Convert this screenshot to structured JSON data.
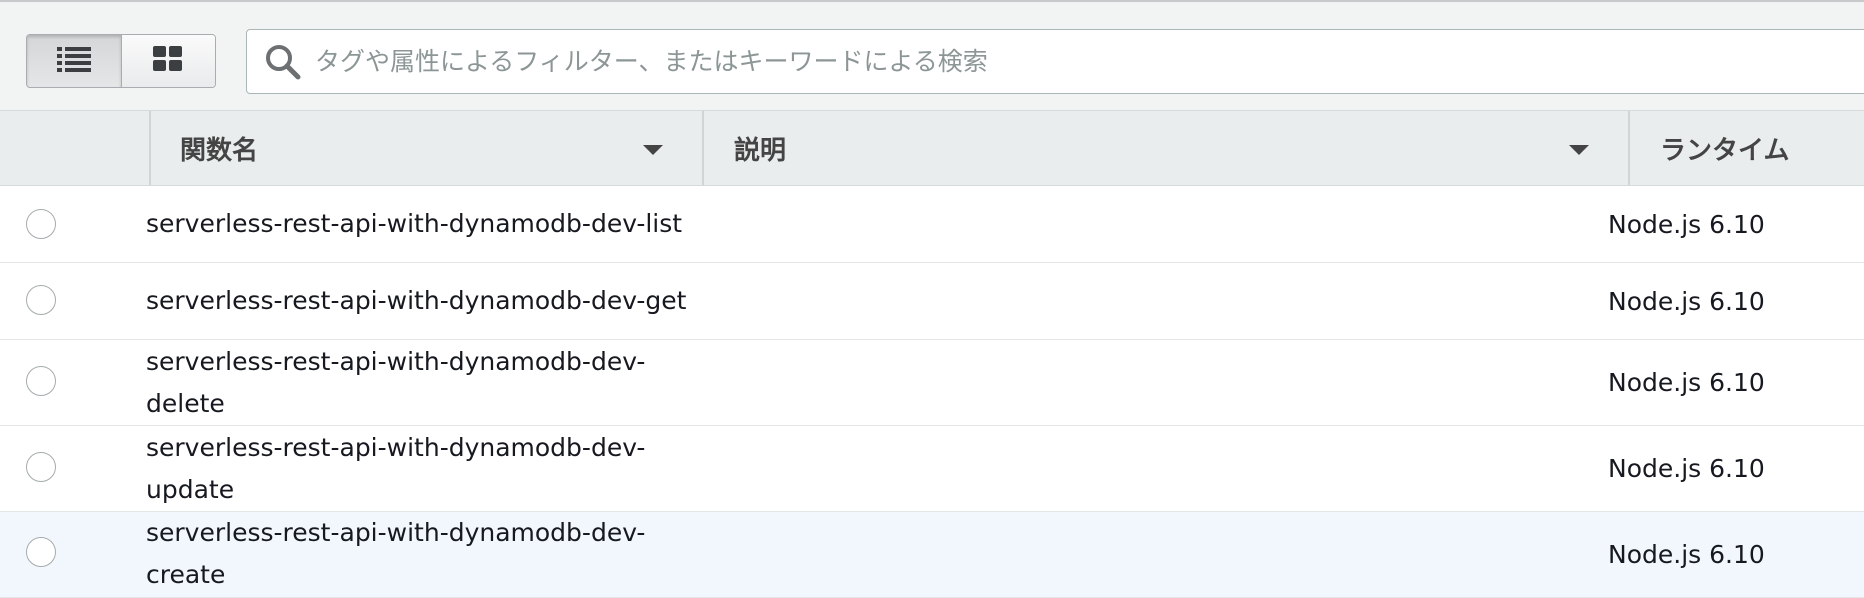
{
  "toolbar": {
    "view_toggle": {
      "list_icon": "list-icon",
      "grid_icon": "grid-icon",
      "active": "list"
    },
    "search": {
      "icon": "search-icon",
      "placeholder": "タグや属性によるフィルター、またはキーワードによる検索",
      "value": ""
    }
  },
  "table": {
    "columns": [
      {
        "label": "関数名",
        "sortable": true
      },
      {
        "label": "説明",
        "sortable": true
      },
      {
        "label": "ランタイム",
        "sortable": false
      }
    ],
    "rows": [
      {
        "name": "serverless-rest-api-with-dynamodb-dev-list",
        "runtime": "Node.js 6.10"
      },
      {
        "name": "serverless-rest-api-with-dynamodb-dev-get",
        "runtime": "Node.js 6.10"
      },
      {
        "name": "serverless-rest-api-with-dynamodb-dev-delete",
        "runtime": "Node.js 6.10"
      },
      {
        "name": "serverless-rest-api-with-dynamodb-dev-update",
        "runtime": "Node.js 6.10"
      },
      {
        "name": "serverless-rest-api-with-dynamodb-dev-create",
        "runtime": "Node.js 6.10"
      }
    ]
  },
  "colors": {
    "toolbar_bg": "#f2f3f3",
    "header_bg": "#eaeded",
    "row_highlight": "#f1f7fc",
    "text": "#16191f"
  }
}
